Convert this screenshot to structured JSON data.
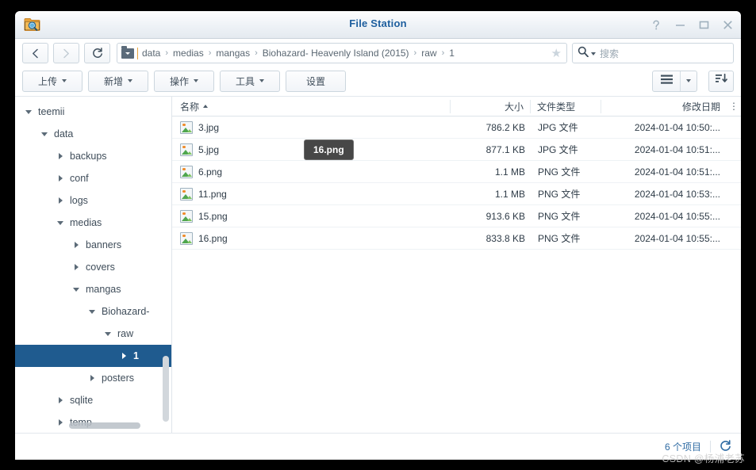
{
  "window": {
    "title": "File Station",
    "app_icon": "folder-search-icon",
    "controls": [
      {
        "name": "help-button",
        "glyph": "?"
      },
      {
        "name": "minimize-button",
        "glyph": "−"
      },
      {
        "name": "maximize-button",
        "glyph": "□"
      },
      {
        "name": "close-button",
        "glyph": "✕"
      }
    ]
  },
  "nav": {
    "back_label": "back-icon",
    "forward_label": "forward-icon",
    "refresh_label": "refresh-icon",
    "breadcrumb": [
      "data",
      "medias",
      "mangas",
      "Biohazard- Heavenly Island (2015)",
      "raw",
      "1"
    ],
    "breadcrumb_separator": "›",
    "favorite_star": "★"
  },
  "search": {
    "placeholder": "搜索",
    "value": ""
  },
  "toolbar": {
    "upload_label": "上传",
    "new_label": "新增",
    "action_label": "操作",
    "tools_label": "工具",
    "settings_label": "设置",
    "view_icon": "list-view-icon",
    "view_caret": "chevron-down-icon",
    "sort_icon": "sort-descending-icon"
  },
  "sidebar": {
    "items": [
      {
        "label": "teemii",
        "depth": 0,
        "state": "expanded",
        "selected": false
      },
      {
        "label": "data",
        "depth": 1,
        "state": "expanded",
        "selected": false
      },
      {
        "label": "backups",
        "depth": 2,
        "state": "collapsed",
        "selected": false
      },
      {
        "label": "conf",
        "depth": 2,
        "state": "collapsed",
        "selected": false
      },
      {
        "label": "logs",
        "depth": 2,
        "state": "collapsed",
        "selected": false
      },
      {
        "label": "medias",
        "depth": 2,
        "state": "expanded",
        "selected": false
      },
      {
        "label": "banners",
        "depth": 3,
        "state": "collapsed",
        "selected": false
      },
      {
        "label": "covers",
        "depth": 3,
        "state": "collapsed",
        "selected": false
      },
      {
        "label": "mangas",
        "depth": 3,
        "state": "expanded",
        "selected": false
      },
      {
        "label": "Biohazard-",
        "depth": 4,
        "state": "expanded",
        "selected": false
      },
      {
        "label": "raw",
        "depth": 5,
        "state": "expanded",
        "selected": false
      },
      {
        "label": "1",
        "depth": 6,
        "state": "collapsed",
        "selected": true
      },
      {
        "label": "posters",
        "depth": 4,
        "state": "collapsed",
        "selected": false
      },
      {
        "label": "sqlite",
        "depth": 2,
        "state": "collapsed",
        "selected": false
      },
      {
        "label": "temp",
        "depth": 2,
        "state": "collapsed",
        "selected": false
      }
    ]
  },
  "filelist": {
    "columns": {
      "name": "名称",
      "size": "大小",
      "type": "文件类型",
      "date": "修改日期",
      "options": "⋮"
    },
    "sort_column": "名称",
    "sort_direction": "asc",
    "rows": [
      {
        "icon": "image-file-icon",
        "name": "3.jpg",
        "size": "786.2 KB",
        "type": "JPG 文件",
        "date": "2024-01-04 10:50:..."
      },
      {
        "icon": "image-file-icon",
        "name": "5.jpg",
        "size": "877.1 KB",
        "type": "JPG 文件",
        "date": "2024-01-04 10:51:..."
      },
      {
        "icon": "image-file-icon",
        "name": "6.png",
        "size": "1.1 MB",
        "type": "PNG 文件",
        "date": "2024-01-04 10:51:..."
      },
      {
        "icon": "image-file-icon",
        "name": "11.png",
        "size": "1.1 MB",
        "type": "PNG 文件",
        "date": "2024-01-04 10:53:..."
      },
      {
        "icon": "image-file-icon",
        "name": "15.png",
        "size": "913.6 KB",
        "type": "PNG 文件",
        "date": "2024-01-04 10:55:..."
      },
      {
        "icon": "image-file-icon",
        "name": "16.png",
        "size": "833.8 KB",
        "type": "PNG 文件",
        "date": "2024-01-04 10:55:..."
      }
    ],
    "tooltip": "16.png"
  },
  "status": {
    "item_count": "6 个项目",
    "refresh_icon": "refresh-icon"
  },
  "watermark": "CSDN @杨浦老苏",
  "colors": {
    "title_blue": "#1d5e9e",
    "selection_blue": "#1f5b8f",
    "status_link": "#2f6ba3",
    "tooltip_bg": "#474747"
  }
}
